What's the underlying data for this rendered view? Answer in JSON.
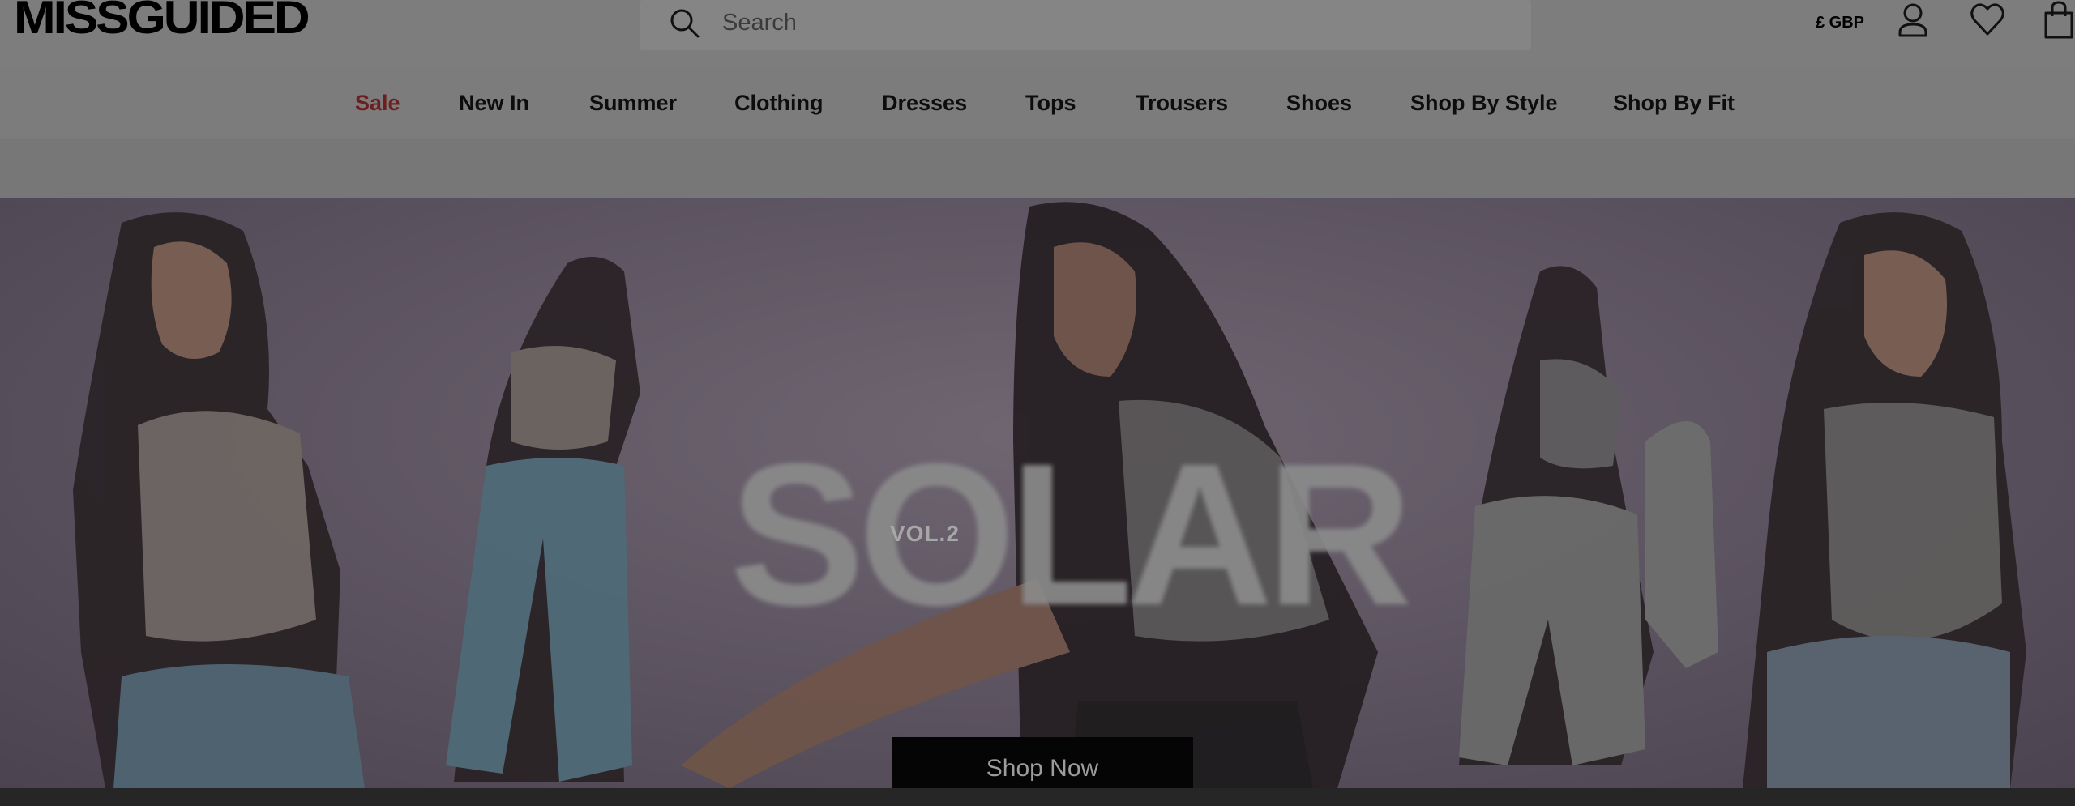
{
  "header": {
    "logo": "MISSGUIDED",
    "search_placeholder": "Search",
    "currency": "£ GBP"
  },
  "nav": {
    "items": [
      {
        "label": "Sale"
      },
      {
        "label": "New In"
      },
      {
        "label": "Summer"
      },
      {
        "label": "Clothing"
      },
      {
        "label": "Dresses"
      },
      {
        "label": "Tops"
      },
      {
        "label": "Trousers"
      },
      {
        "label": "Shoes"
      },
      {
        "label": "Shop By Style"
      },
      {
        "label": "Shop By Fit"
      }
    ]
  },
  "hero": {
    "title": "SOLAR",
    "subtitle": "VOL.2",
    "cta_label": "Shop Now"
  },
  "colors": {
    "sale": "#6b1f1f",
    "overlay": "#7a7a7a",
    "cta_bg": "#050505"
  },
  "icons": [
    "search-icon",
    "account-icon",
    "heart-icon",
    "bag-icon"
  ]
}
